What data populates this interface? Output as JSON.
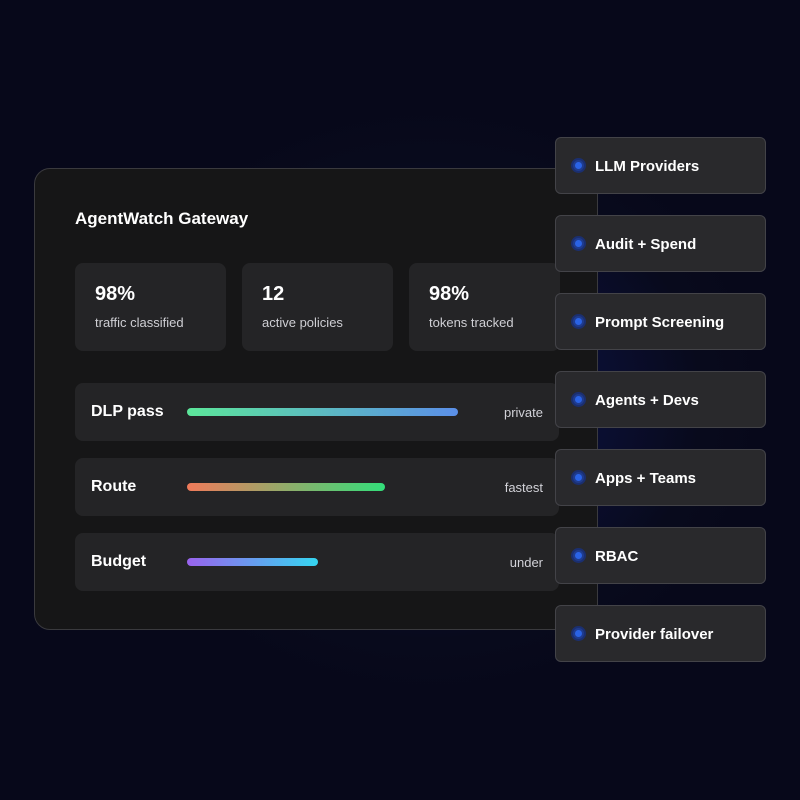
{
  "gateway": {
    "title": "AgentWatch Gateway",
    "stats": [
      {
        "value": "98%",
        "label": "traffic classified"
      },
      {
        "value": "12",
        "label": "active policies"
      },
      {
        "value": "98%",
        "label": "tokens tracked"
      }
    ],
    "metrics": [
      {
        "label": "DLP pass",
        "status": "private",
        "level": 0.56,
        "gradient": [
          "#5ce69a",
          "#5b8fe8"
        ]
      },
      {
        "label": "Route",
        "status": "fastest",
        "level": 0.41,
        "gradient": [
          "#f07a5a",
          "#33de7a"
        ]
      },
      {
        "label": "Budget",
        "status": "under",
        "level": 0.27,
        "gradient": [
          "#9a63ee",
          "#35d6f0"
        ]
      }
    ]
  },
  "features": [
    {
      "label": "LLM Providers"
    },
    {
      "label": "Audit + Spend"
    },
    {
      "label": "Prompt Screening"
    },
    {
      "label": "Agents + Devs"
    },
    {
      "label": "Apps + Teams"
    },
    {
      "label": "RBAC"
    },
    {
      "label": "Provider failover"
    }
  ],
  "colors": {
    "background": "#080a1c",
    "accent_blue": "#2a63e6",
    "card": "#161617",
    "panel": "#242426"
  }
}
